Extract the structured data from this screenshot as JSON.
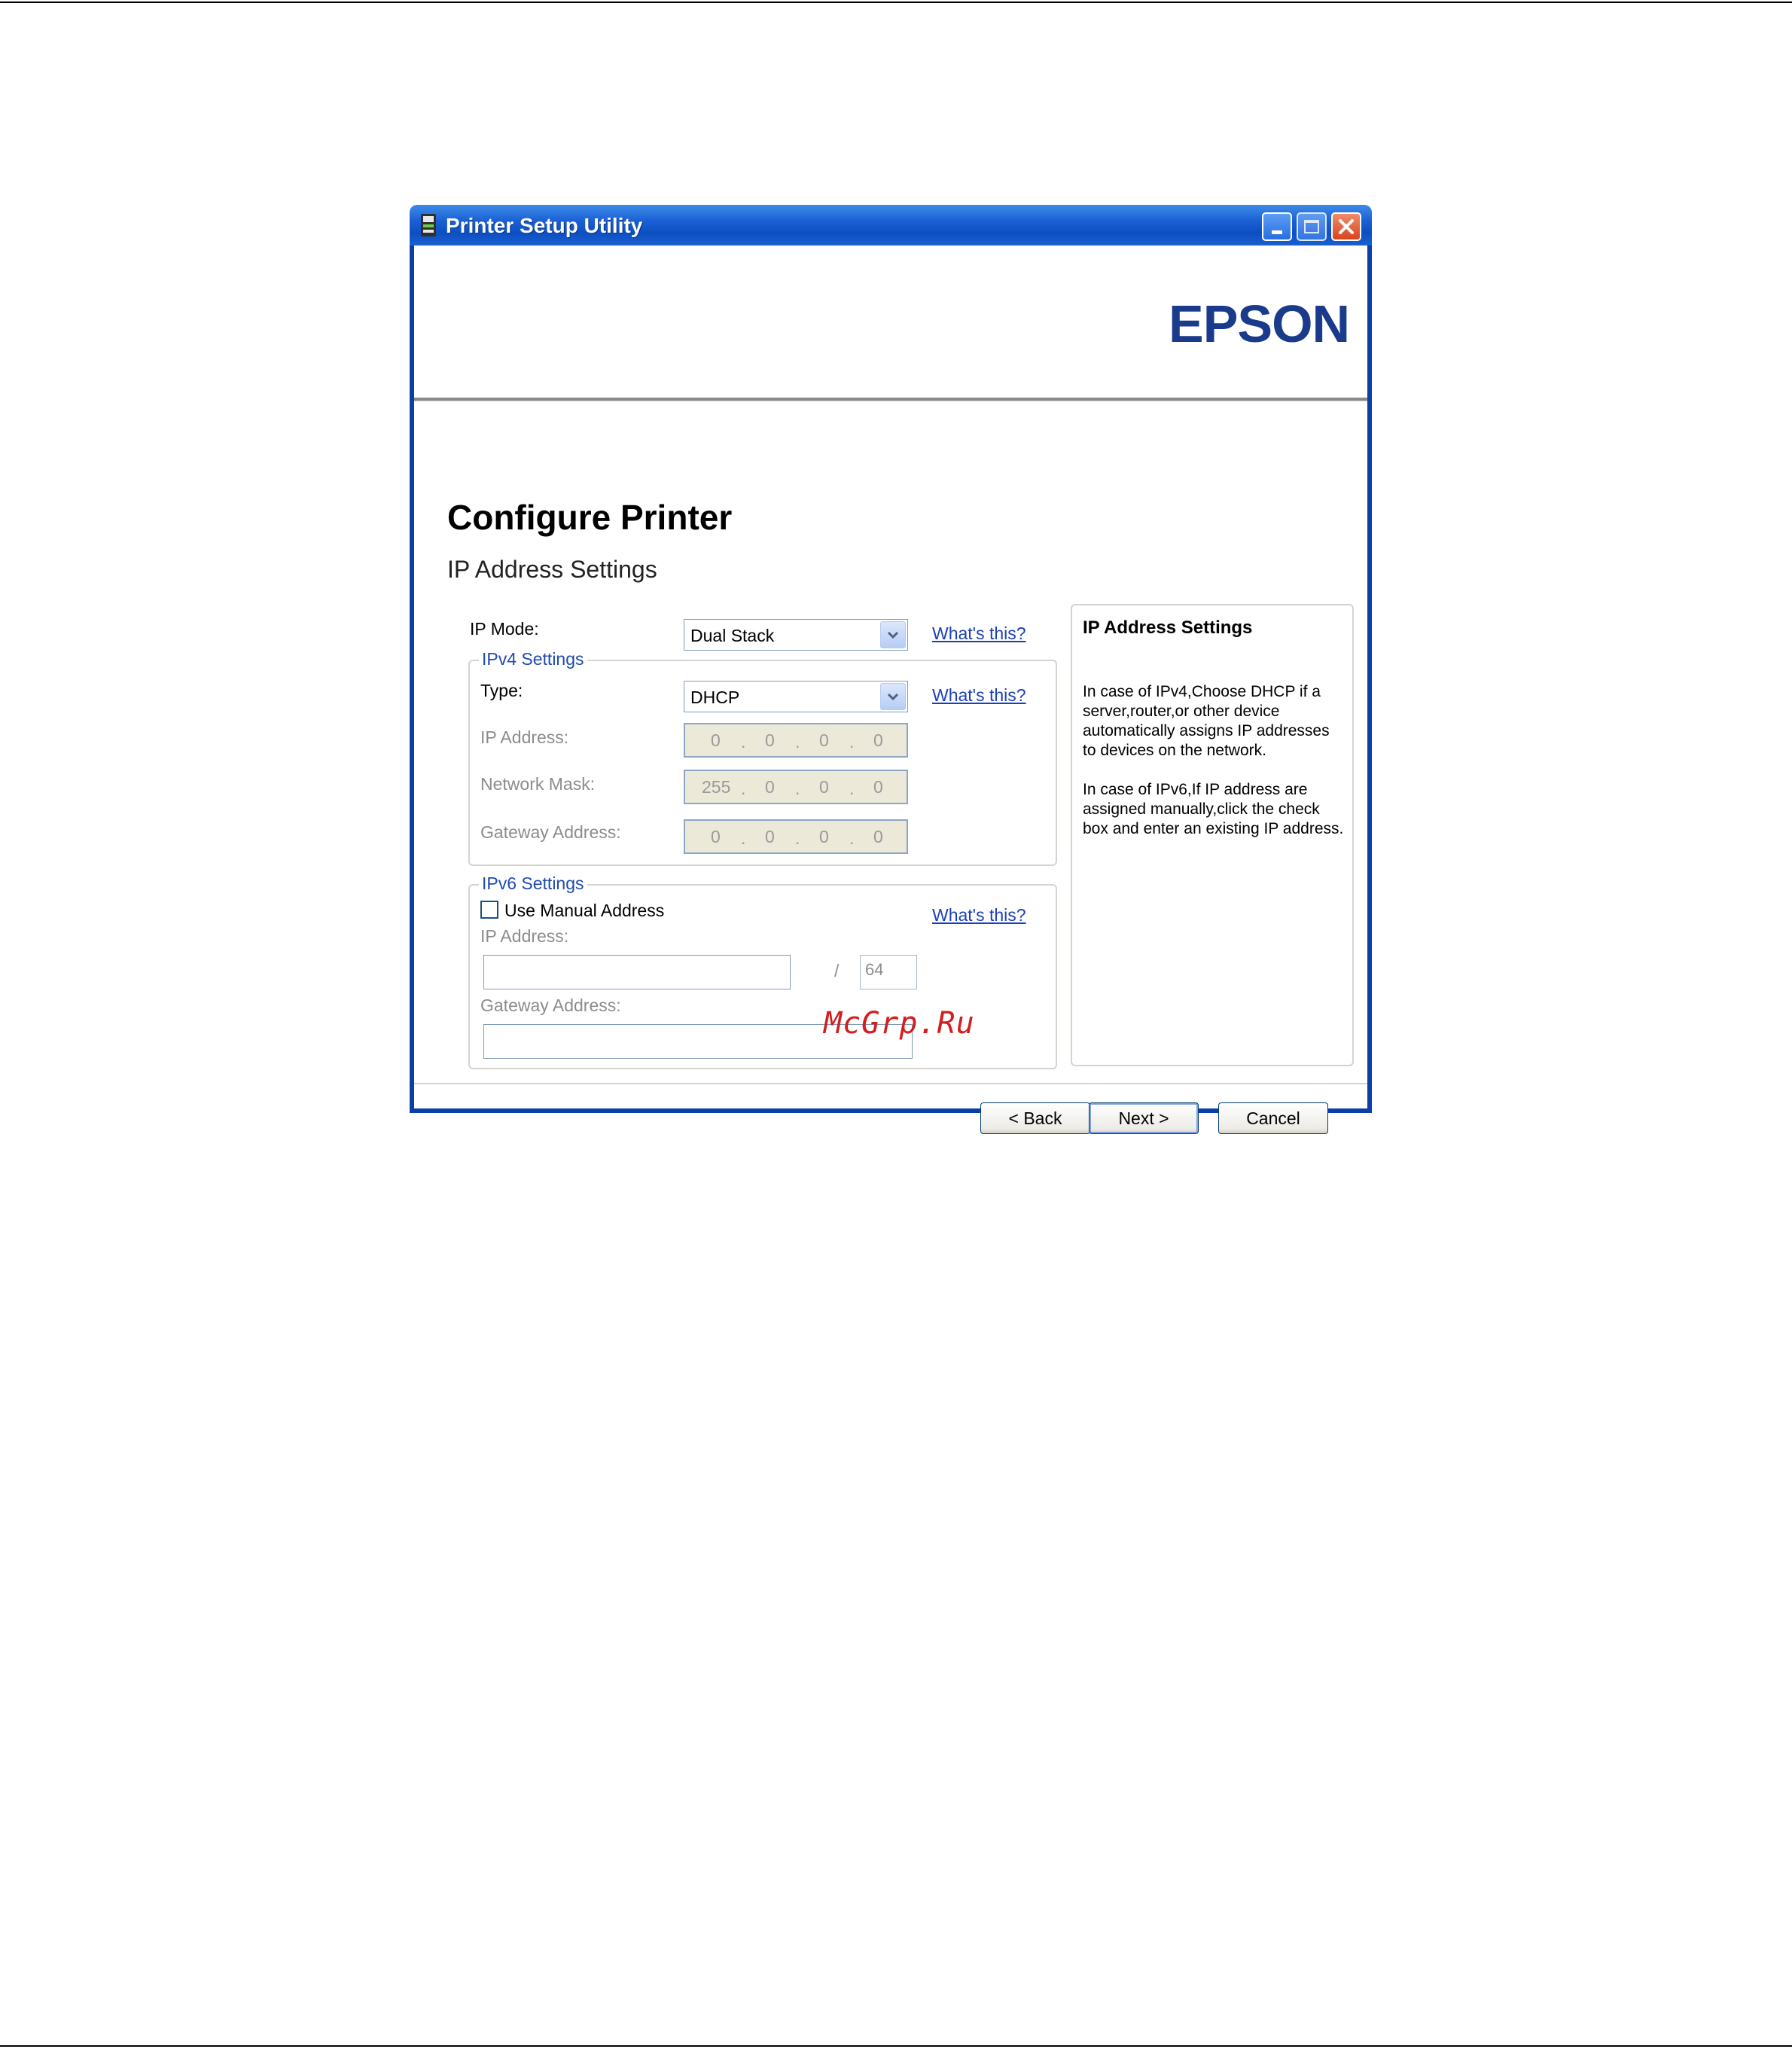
{
  "window": {
    "title": "Printer Setup Utility",
    "brand_logo": "EPSON"
  },
  "page": {
    "heading": "Configure Printer",
    "subheading": "IP Address Settings"
  },
  "ip_mode": {
    "label": "IP Mode:",
    "value": "Dual Stack",
    "help_link": "What's this?"
  },
  "ipv4": {
    "legend": "IPv4 Settings",
    "type_label": "Type:",
    "type_value": "DHCP",
    "help_link": "What's this?",
    "ip_address_label": "IP Address:",
    "ip_address": [
      "0",
      "0",
      "0",
      "0"
    ],
    "network_mask_label": "Network Mask:",
    "network_mask": [
      "255",
      "0",
      "0",
      "0"
    ],
    "gateway_label": "Gateway Address:",
    "gateway": [
      "0",
      "0",
      "0",
      "0"
    ]
  },
  "ipv6": {
    "legend": "IPv6 Settings",
    "manual_checkbox_label": "Use Manual Address",
    "manual_checked": false,
    "help_link": "What's this?",
    "ip_address_label": "IP Address:",
    "ip_address_value": "",
    "prefix_separator": "/",
    "prefix_length": "64",
    "gateway_label": "Gateway Address:",
    "gateway_value": ""
  },
  "info_panel": {
    "title": "IP Address Settings",
    "paragraph1": "In case of IPv4,Choose DHCP if a server,router,or other device automatically assigns IP addresses to devices on the network.",
    "paragraph2": "In case of IPv6,If IP address are assigned manually,click the check box and enter an existing IP address."
  },
  "buttons": {
    "back": "< Back",
    "next": "Next >",
    "cancel": "Cancel"
  },
  "watermark": "McGrp.Ru",
  "colors": {
    "titlebar": "#0c4fc2",
    "brand": "#1a3a8c",
    "link": "#1a3fb8",
    "watermark": "#d41e1e"
  }
}
